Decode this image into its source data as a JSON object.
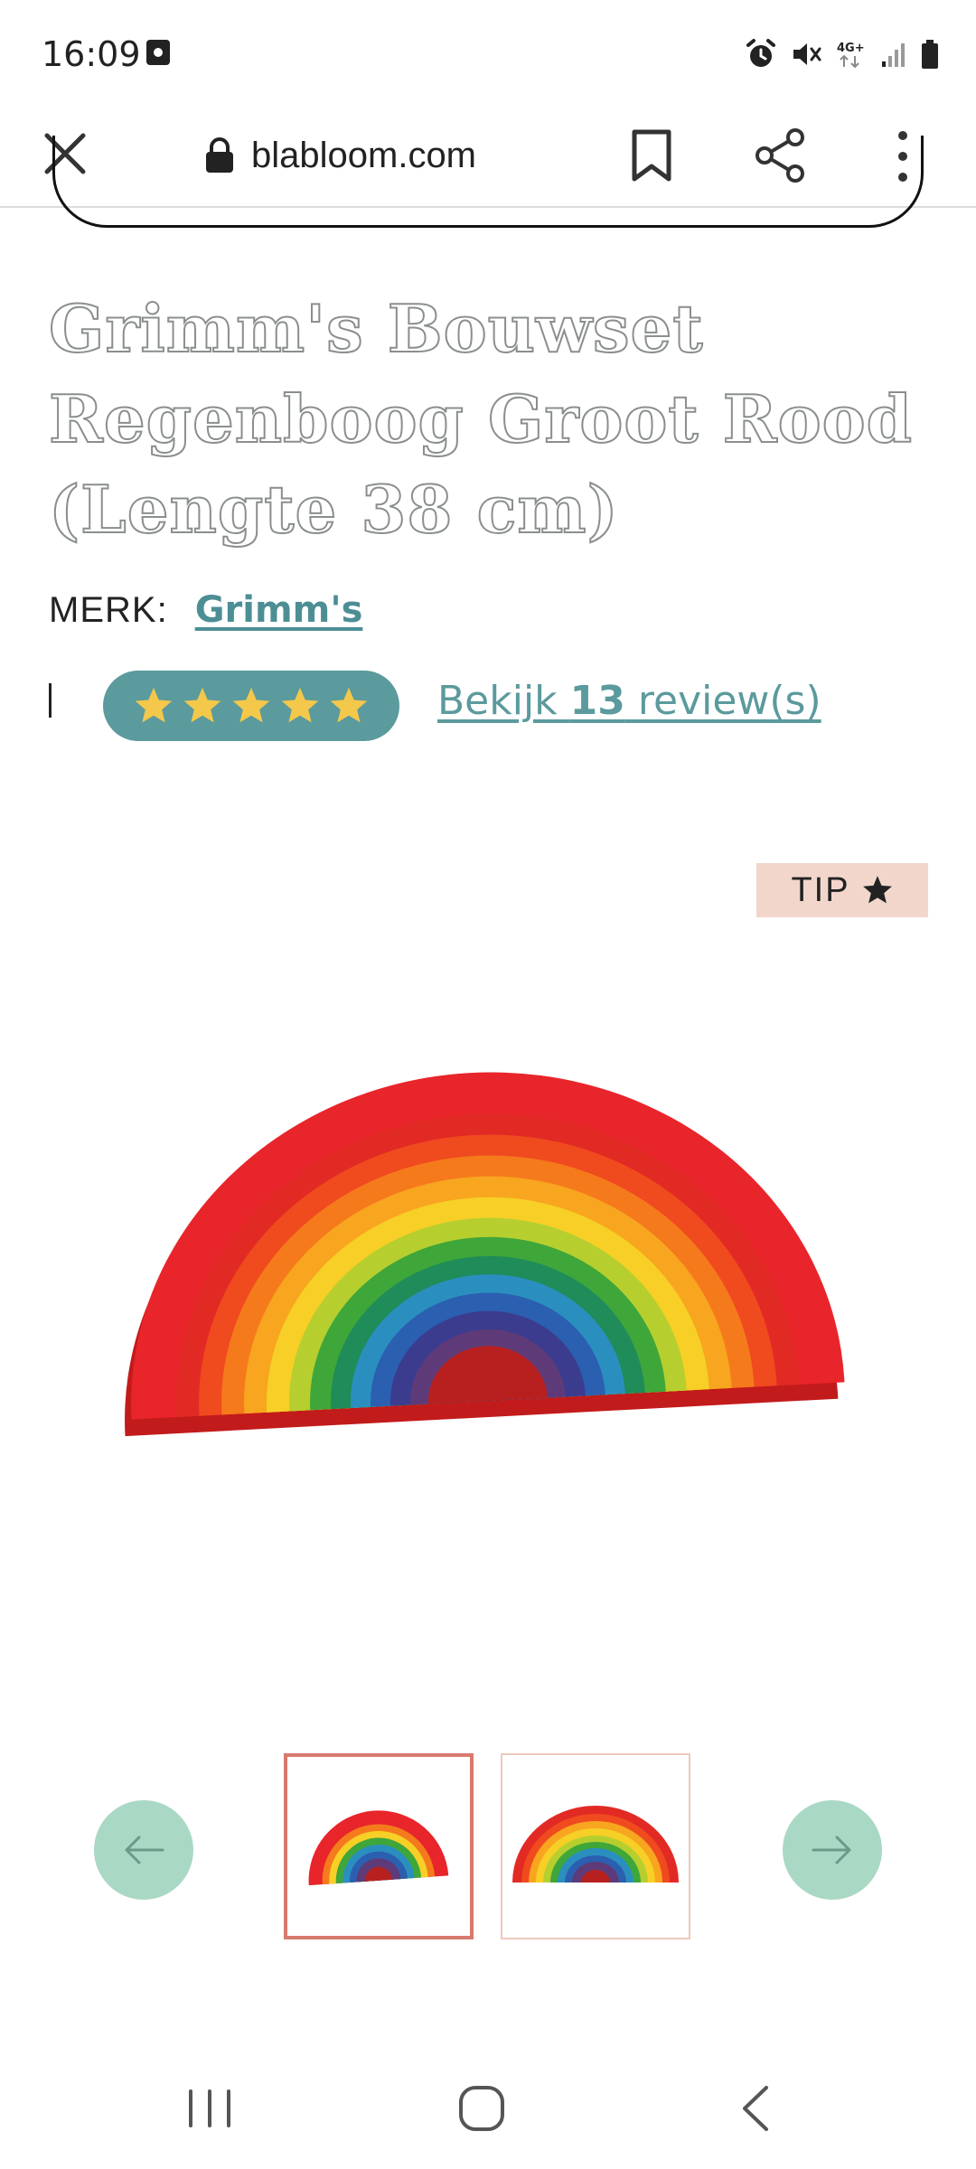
{
  "status_bar": {
    "time": "16:09",
    "icons": [
      "alarm-icon",
      "mute-icon",
      "network-4g-icon",
      "signal-icon",
      "battery-icon"
    ],
    "network_label": "4G+"
  },
  "browser": {
    "url": "blabloom.com",
    "icons": [
      "close-icon",
      "lock-icon",
      "bookmark-icon",
      "share-icon",
      "more-vert-icon"
    ]
  },
  "product": {
    "title": "Grimm's Bouwset Regenboog Groot Rood (Lengte 38 cm)",
    "brand_label": "MERK:",
    "brand_name": "Grimm's",
    "rating_stars": 5,
    "review_prefix": "Bekijk ",
    "review_count": "13",
    "review_suffix": " review(s)",
    "badge_text": "TIP",
    "image_alt": "rainbow-stacker-image"
  },
  "carousel": {
    "thumbnails": [
      "thumbnail-1",
      "thumbnail-2"
    ],
    "selected_index": 0
  },
  "colors": {
    "accent_teal": "#5b9a9d",
    "star_yellow": "#f4c84a",
    "carousel_button": "#a9d8c4",
    "badge_bg": "#f2d6cc",
    "thumb_selected_border": "#d77a6e"
  },
  "nav": {
    "icons": [
      "recent-apps-icon",
      "home-icon",
      "back-icon"
    ]
  }
}
